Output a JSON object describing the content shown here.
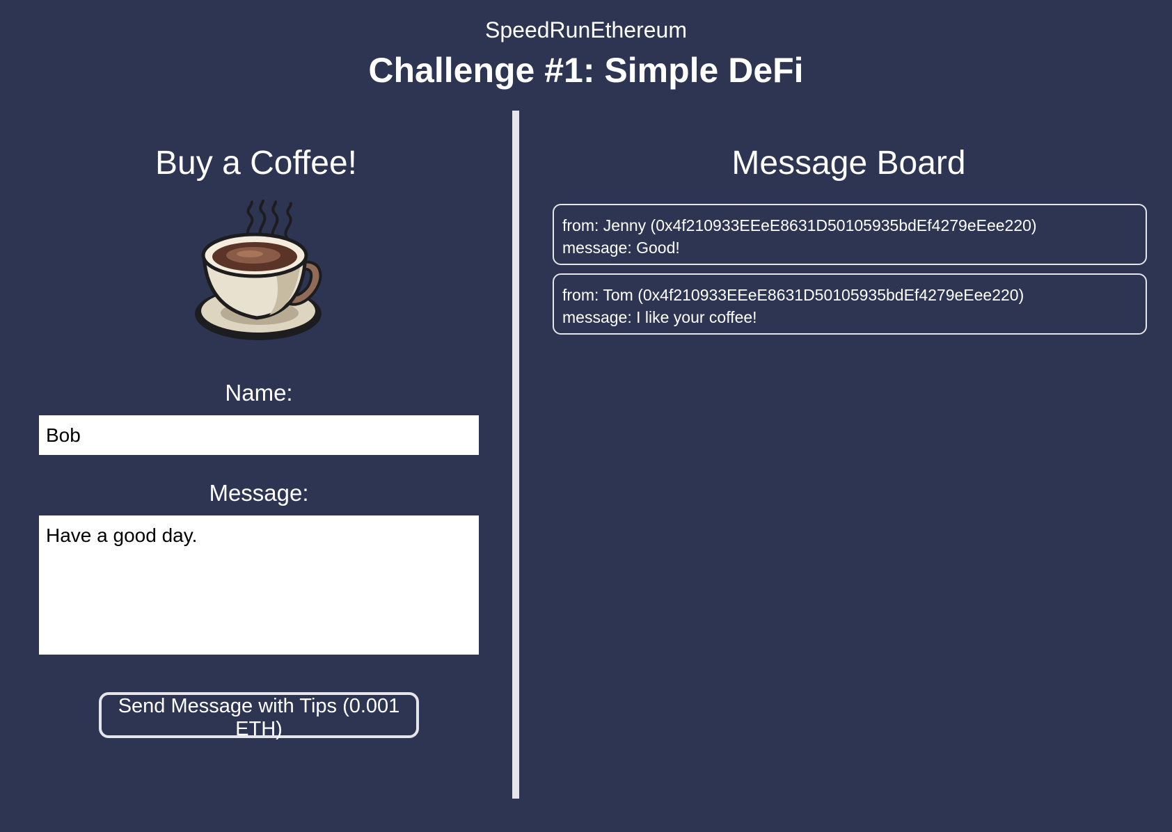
{
  "header": {
    "site_name": "SpeedRunEthereum",
    "title": "Challenge #1: Simple DeFi"
  },
  "buy_coffee": {
    "heading": "Buy a Coffee!",
    "icon": "coffee-cup-icon",
    "name_label": "Name:",
    "name_value": "Bob",
    "message_label": "Message:",
    "message_value": "Have a good day.",
    "send_button": "Send Message with Tips (0.001 ETH)"
  },
  "message_board": {
    "heading": "Message Board",
    "messages": [
      {
        "from": "from: Jenny (0x4f210933EEeE8631D50105935bdEf4279eEee220)",
        "message": "message: Good!"
      },
      {
        "from": "from: Tom (0x4f210933EEeE8631D50105935bdEf4279eEee220)",
        "message": "message: I like your coffee!"
      }
    ]
  },
  "colors": {
    "background": "#2d3552",
    "text": "#ffffff",
    "divider": "#e6e6ea",
    "input_background": "#ffffff"
  }
}
